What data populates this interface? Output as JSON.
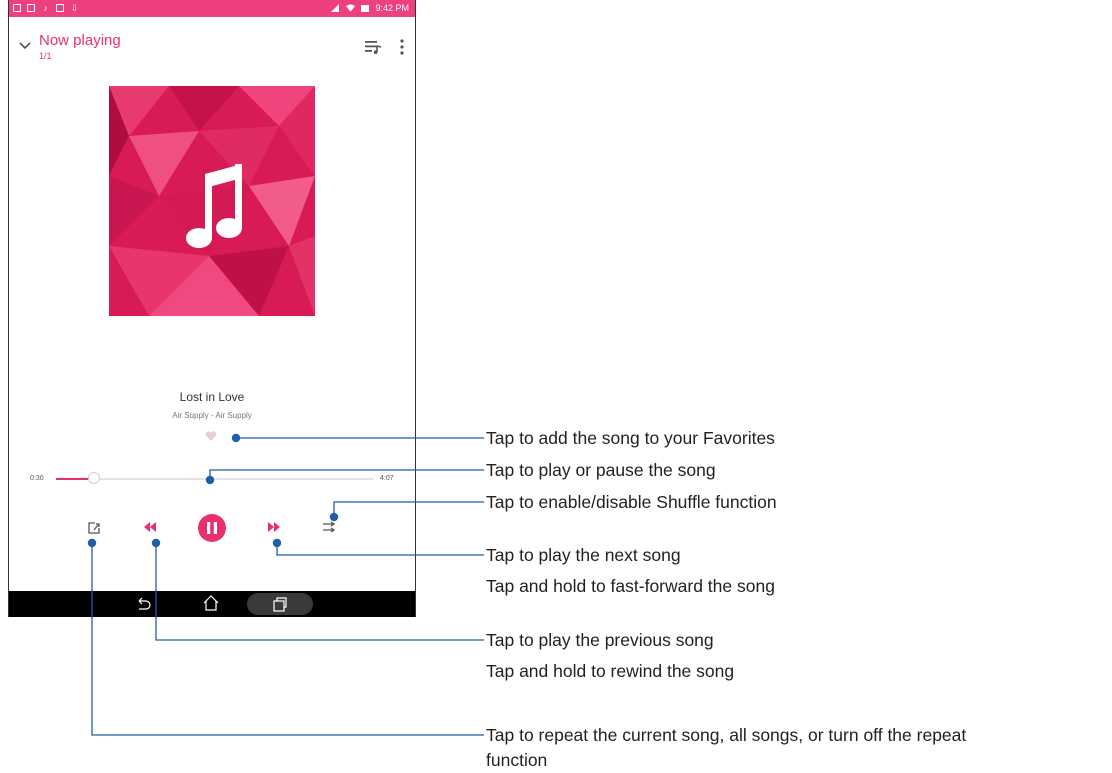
{
  "status_bar": {
    "time": "9:42 PM"
  },
  "header": {
    "title": "Now playing",
    "track_count": "1/1"
  },
  "song": {
    "title": "Lost in Love",
    "artist": "Air Supply - Air Supply"
  },
  "progress": {
    "elapsed": "0:30",
    "total": "4:07",
    "fraction": 0.121
  },
  "colors": {
    "accent": "#e8306f",
    "status_bar": "#ee3f80",
    "callout_line": "#1f5fa6"
  },
  "icons": [
    "chevron-down-icon",
    "queue-music-icon",
    "more-vert-icon",
    "music-note-icon",
    "heart-icon",
    "repeat-icon",
    "rewind-icon",
    "pause-icon",
    "fast-forward-icon",
    "shuffle-icon",
    "back-icon",
    "home-icon",
    "recents-icon"
  ],
  "callouts": {
    "favorites": "Tap to add the song to your Favorites",
    "play_pause": "Tap to play or pause the song",
    "shuffle": "Tap to enable/disable Shuffle function",
    "next_1": "Tap to play the next song",
    "next_2": "Tap and hold to fast-forward the song",
    "prev_1": "Tap to play the previous song",
    "prev_2": "Tap and hold to rewind the song",
    "repeat_1": "Tap to repeat the current song, all songs, or turn off the repeat",
    "repeat_2": "function"
  }
}
